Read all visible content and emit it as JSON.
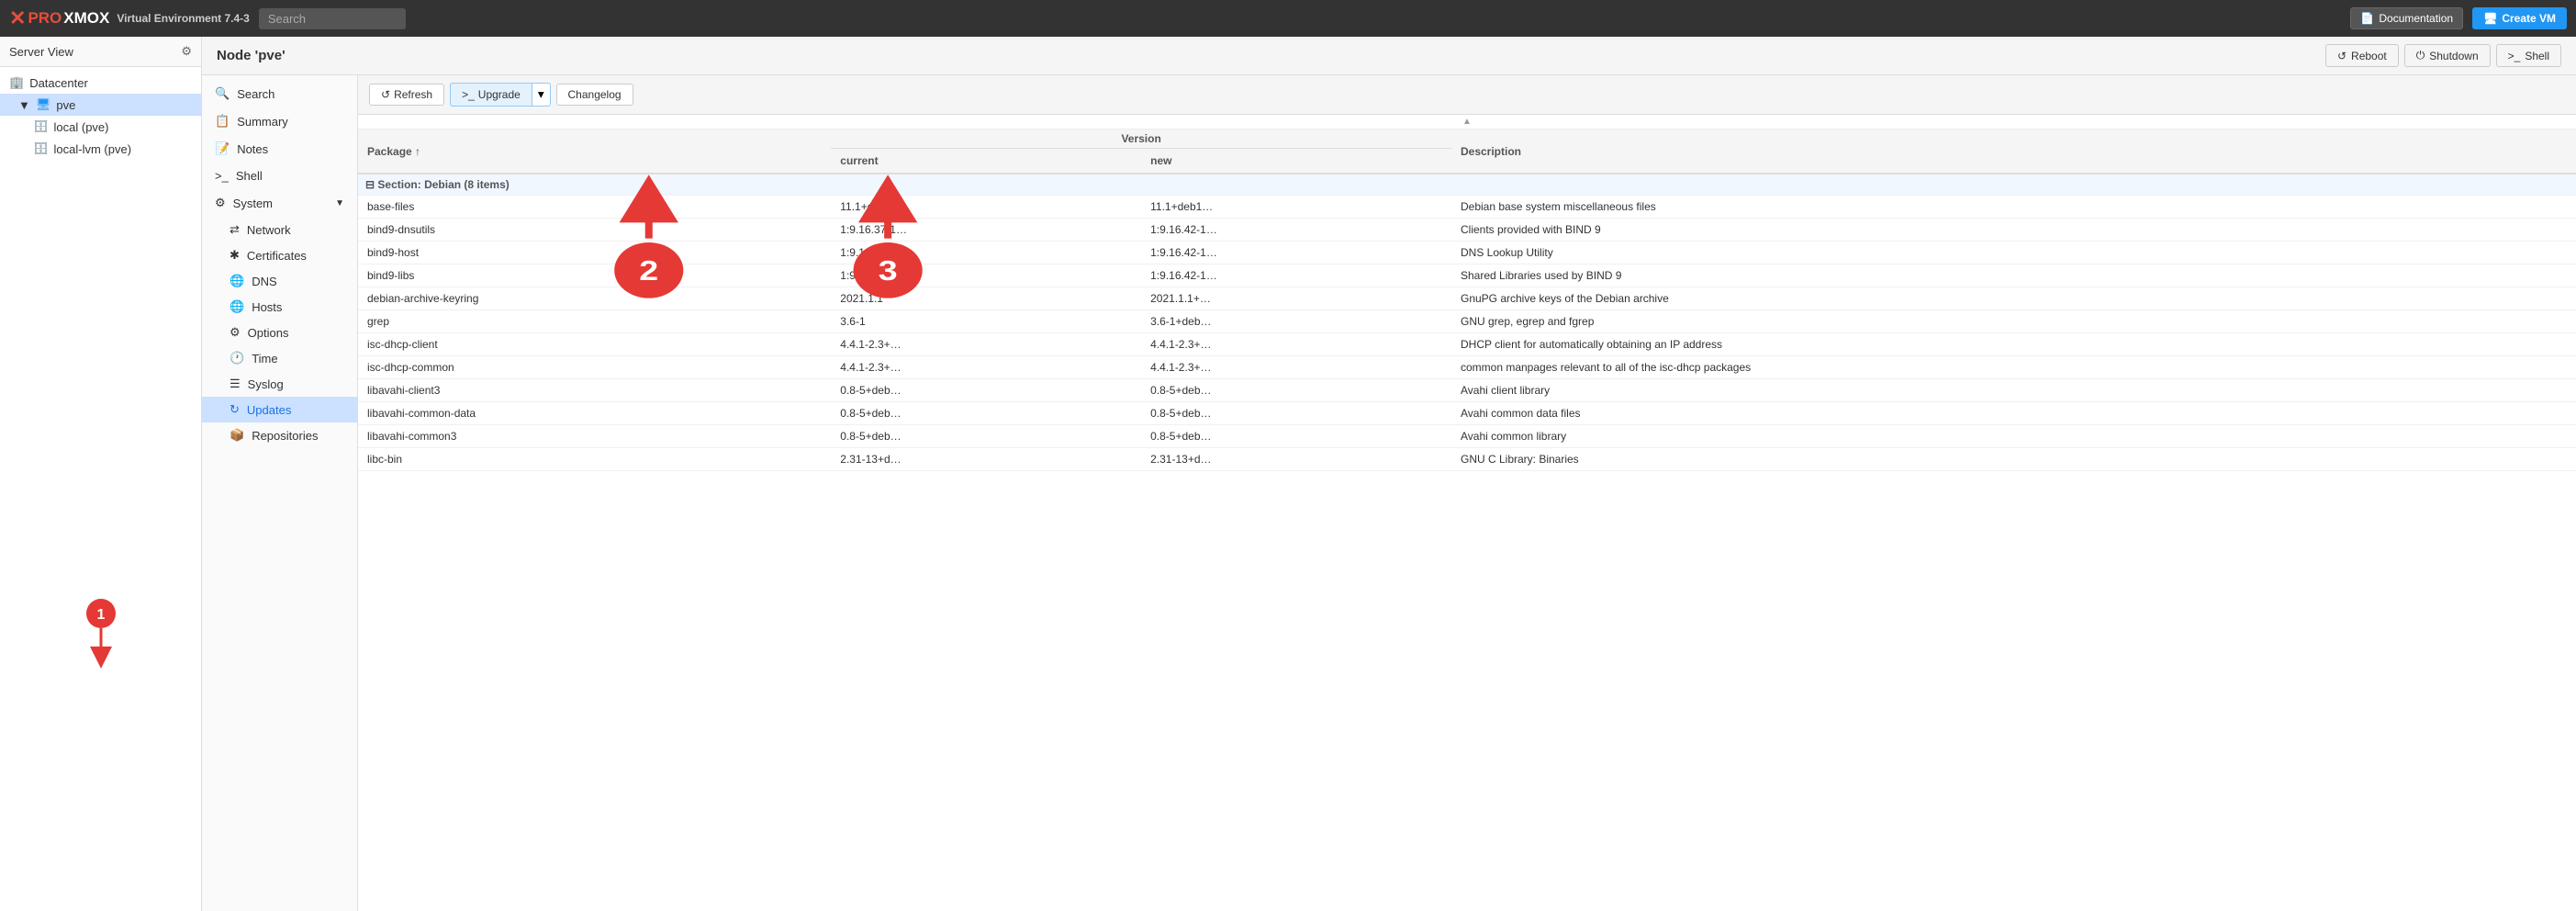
{
  "topbar": {
    "logo_text": "PROXMOX",
    "subtitle": "Virtual Environment 7.4-3",
    "search_placeholder": "Search",
    "doc_btn": "Documentation",
    "create_btn": "Create VM"
  },
  "sidebar": {
    "title": "Server View",
    "datacenter": "Datacenter",
    "server": "pve",
    "storage1": "local (pve)",
    "storage2": "local-lvm (pve)"
  },
  "node_header": {
    "title": "Node 'pve'",
    "reboot": "Reboot",
    "shutdown": "Shutdown",
    "shell": "Shell"
  },
  "nav": {
    "search": "Search",
    "summary": "Summary",
    "notes": "Notes",
    "shell": "Shell",
    "system": "System",
    "network": "Network",
    "certificates": "Certificates",
    "dns": "DNS",
    "hosts": "Hosts",
    "options": "Options",
    "time": "Time",
    "syslog": "Syslog",
    "updates": "Updates",
    "repositories": "Repositories"
  },
  "pkg_toolbar": {
    "refresh": "Refresh",
    "upgrade": "Upgrade",
    "changelog": "Changelog"
  },
  "table": {
    "col_package": "Package",
    "col_version": "Version",
    "col_current": "current",
    "col_new": "new",
    "col_description": "Description",
    "group_label": "Section: Debian (8 items)",
    "packages": [
      {
        "name": "base-files",
        "current": "11.1+deb1…",
        "new": "11.1+deb1…",
        "desc": "Debian base system miscellaneous files"
      },
      {
        "name": "bind9-dnsutils",
        "current": "1:9.16.37-1…",
        "new": "1:9.16.42-1…",
        "desc": "Clients provided with BIND 9"
      },
      {
        "name": "bind9-host",
        "current": "1:9.16.37-1…",
        "new": "1:9.16.42-1…",
        "desc": "DNS Lookup Utility"
      },
      {
        "name": "bind9-libs",
        "current": "1:9.16.37-1…",
        "new": "1:9.16.42-1…",
        "desc": "Shared Libraries used by BIND 9"
      },
      {
        "name": "debian-archive-keyring",
        "current": "2021.1.1",
        "new": "2021.1.1+…",
        "desc": "GnuPG archive keys of the Debian archive"
      },
      {
        "name": "grep",
        "current": "3.6-1",
        "new": "3.6-1+deb…",
        "desc": "GNU grep, egrep and fgrep"
      },
      {
        "name": "isc-dhcp-client",
        "current": "4.4.1-2.3+…",
        "new": "4.4.1-2.3+…",
        "desc": "DHCP client for automatically obtaining an IP address"
      },
      {
        "name": "isc-dhcp-common",
        "current": "4.4.1-2.3+…",
        "new": "4.4.1-2.3+…",
        "desc": "common manpages relevant to all of the isc-dhcp packages"
      },
      {
        "name": "libavahi-client3",
        "current": "0.8-5+deb…",
        "new": "0.8-5+deb…",
        "desc": "Avahi client library"
      },
      {
        "name": "libavahi-common-data",
        "current": "0.8-5+deb…",
        "new": "0.8-5+deb…",
        "desc": "Avahi common data files"
      },
      {
        "name": "libavahi-common3",
        "current": "0.8-5+deb…",
        "new": "0.8-5+deb…",
        "desc": "Avahi common library"
      },
      {
        "name": "libc-bin",
        "current": "2.31-13+d…",
        "new": "2.31-13+d…",
        "desc": "GNU C Library: Binaries"
      }
    ]
  },
  "annotations": {
    "one": "1",
    "two": "2",
    "three": "3"
  }
}
